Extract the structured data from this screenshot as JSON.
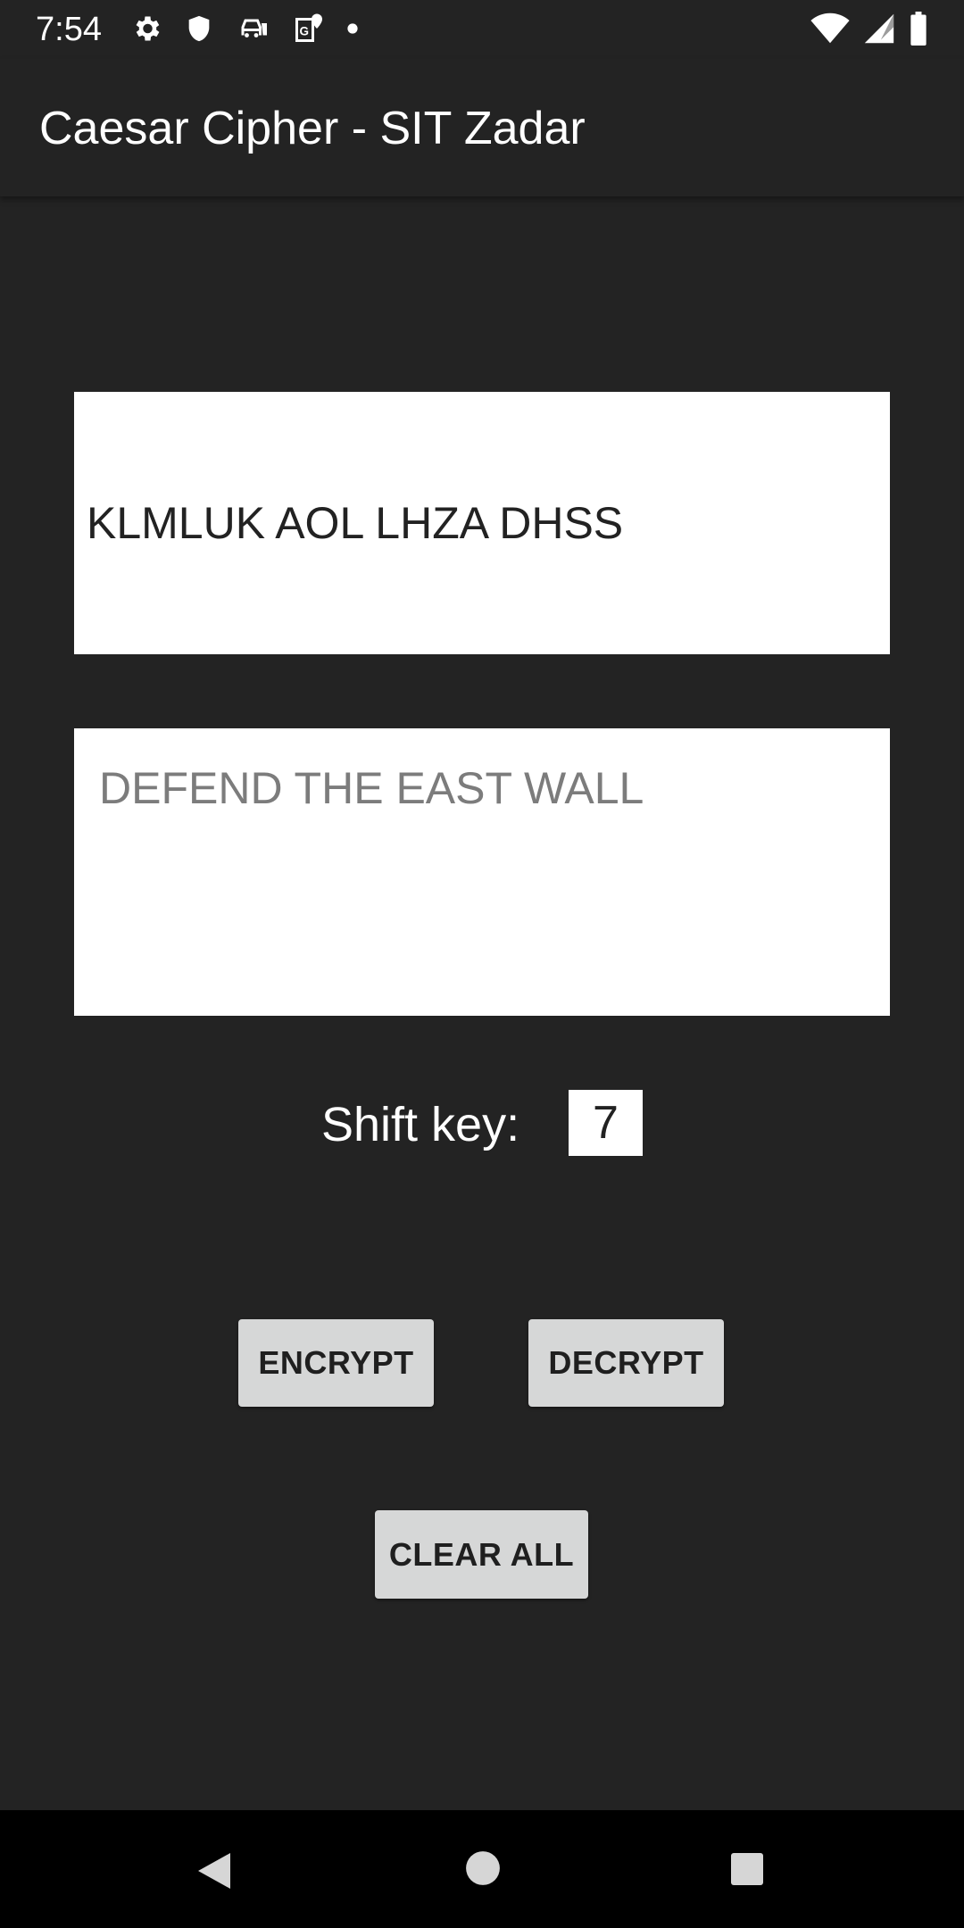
{
  "status_bar": {
    "time": "7:54",
    "left_icons": [
      "gear-icon",
      "shield-icon",
      "car-icon",
      "maps-icon",
      "dot-icon"
    ],
    "right_icons": [
      "wifi-icon",
      "signal-icon",
      "battery-icon"
    ]
  },
  "app_bar": {
    "title": "Caesar Cipher - SIT Zadar"
  },
  "main": {
    "cipher_text": "KLMLUK AOL LHZA DHSS",
    "plain_text_placeholder": "DEFEND THE EAST WALL",
    "shift_label": "Shift key:",
    "shift_value": "7",
    "encrypt_label": "ENCRYPT",
    "decrypt_label": "DECRYPT",
    "clear_label": "CLEAR ALL"
  },
  "nav_bar": {
    "buttons": [
      "back-icon",
      "home-icon",
      "recents-icon"
    ]
  },
  "colors": {
    "background": "#232323",
    "field": "#ffffff",
    "button": "#d6d7d7",
    "placeholder": "#7c7c7c"
  }
}
